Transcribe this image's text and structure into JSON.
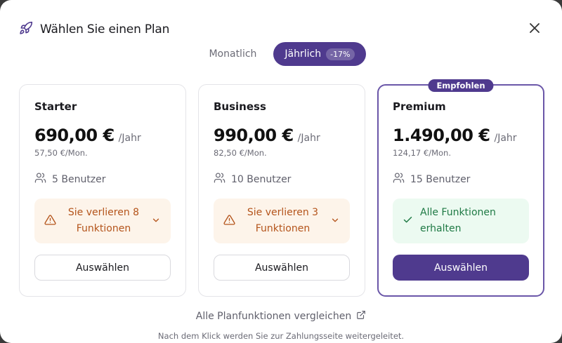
{
  "dialog": {
    "title": "Wählen Sie einen Plan"
  },
  "billing": {
    "monthly_label": "Monatlich",
    "yearly_label": "Jährlich",
    "yearly_discount": "-17%",
    "selected": "yearly"
  },
  "plans": [
    {
      "name": "Starter",
      "price": "690,00 €",
      "period": "/Jahr",
      "monthly": "57,50 €/Mon.",
      "users": "5 Benutzer",
      "feature_status": "warning",
      "feature_text": "Sie verlieren 8 Funktionen",
      "button": "Auswählen"
    },
    {
      "name": "Business",
      "price": "990,00 €",
      "period": "/Jahr",
      "monthly": "82,50 €/Mon.",
      "users": "10 Benutzer",
      "feature_status": "warning",
      "feature_text": "Sie verlieren 3 Funktionen",
      "button": "Auswählen"
    },
    {
      "name": "Premium",
      "badge": "Empfohlen",
      "price": "1.490,00 €",
      "period": "/Jahr",
      "monthly": "124,17 €/Mon.",
      "users": "15 Benutzer",
      "feature_status": "ok",
      "feature_text": "Alle Funktionen erhalten",
      "button": "Auswählen"
    }
  ],
  "compare_link": "Alle Planfunktionen vergleichen",
  "footer_note": "Nach dem Klick werden Sie zur Zahlungsseite weitergeleitet.",
  "colors": {
    "accent": "#4f3a8e",
    "warning_bg": "#fdf4ea",
    "warning_fg": "#b4541b",
    "success_bg": "#ecfaf1",
    "success_fg": "#1f7a45"
  },
  "icons": {
    "title": "rocket-icon",
    "close": "close-icon",
    "users": "users-icon",
    "warning": "warning-triangle-icon",
    "chevron": "chevron-down-icon",
    "check": "check-icon",
    "external": "external-link-icon"
  }
}
